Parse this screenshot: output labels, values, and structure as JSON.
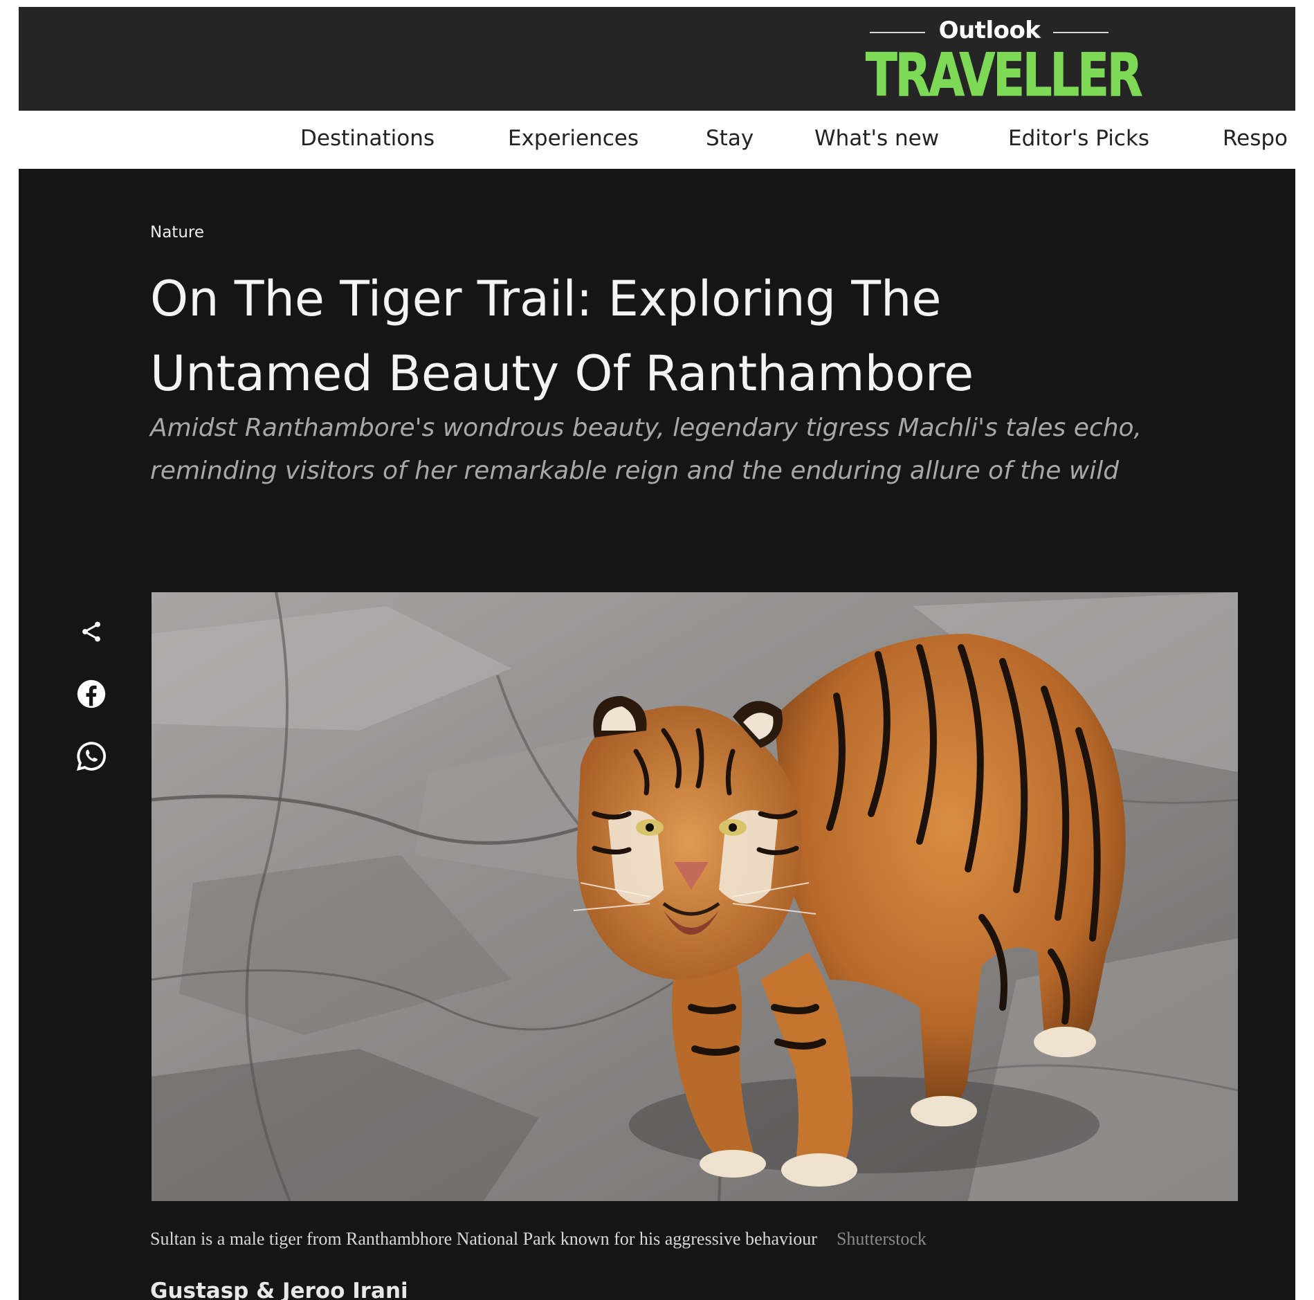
{
  "brand": {
    "logo_top": "Outlook",
    "logo_bottom": "TRAVELLER"
  },
  "nav": {
    "items": [
      {
        "label": "Destinations"
      },
      {
        "label": "Experiences"
      },
      {
        "label": "Stay"
      },
      {
        "label": "What's new"
      },
      {
        "label": "Editor's Picks"
      },
      {
        "label": "Respo"
      }
    ]
  },
  "article": {
    "category": "Nature",
    "title": "On The Tiger Trail: Exploring The Untamed Beauty Of Ranthambore",
    "standfirst": "Amidst Ranthambore's wondrous beauty, legendary tigress Machli's tales echo, reminding visitors of her remarkable reign and the enduring allure of the wild",
    "image_caption": "Sultan is a male tiger from Ranthambhore National Park known for his aggressive behaviour",
    "image_credit": "Shutterstock",
    "byline": "Gustasp & Jeroo Irani"
  },
  "share": {
    "icons": [
      "share-icon",
      "facebook-icon",
      "whatsapp-icon"
    ]
  },
  "colors": {
    "header_bg": "#252525",
    "article_bg": "#151515",
    "brand_green": "#7ed957",
    "nav_bg": "#ffffff"
  }
}
